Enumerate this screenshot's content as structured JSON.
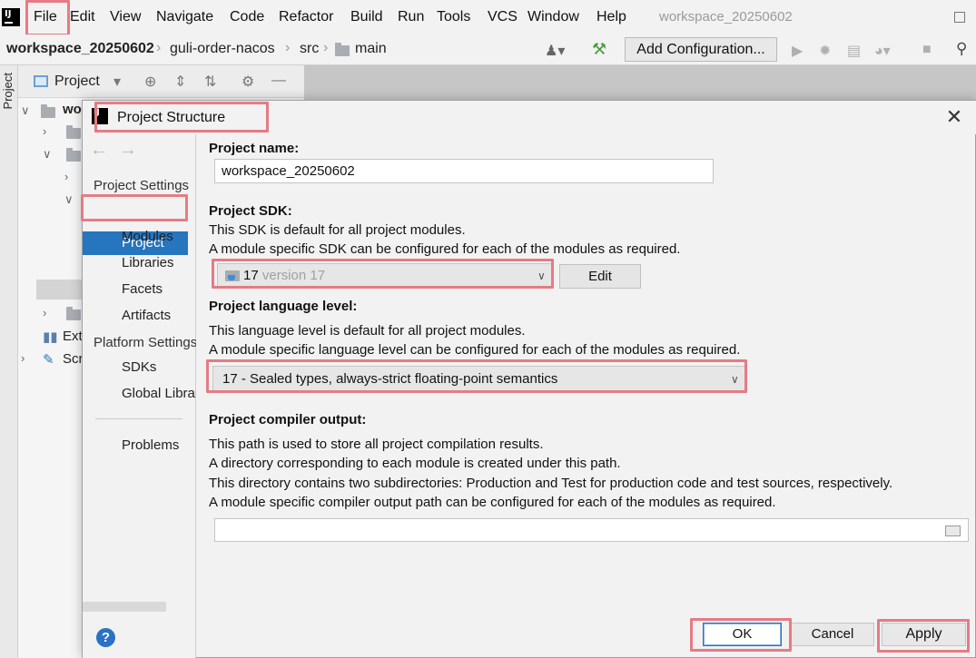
{
  "menubar": {
    "items": [
      "File",
      "Edit",
      "View",
      "Navigate",
      "Code",
      "Refactor",
      "Build",
      "Run",
      "Tools",
      "VCS",
      "Window",
      "Help"
    ],
    "window_title": "workspace_20250602"
  },
  "navbar": {
    "breadcrumbs": [
      "workspace_20250602",
      "guli-order-nacos",
      "src",
      "main"
    ],
    "add_configuration": "Add Configuration..."
  },
  "tool_window": {
    "strip_label": "Project",
    "title": "Project",
    "tree_visible": [
      "wo",
      "Ext",
      "Scr"
    ]
  },
  "dialog": {
    "title": "Project Structure",
    "sidebar": {
      "project_settings_header": "Project Settings",
      "project_settings_items": [
        "Project",
        "Modules",
        "Libraries",
        "Facets",
        "Artifacts"
      ],
      "selected": "Project",
      "platform_settings_header": "Platform Settings",
      "platform_settings_items": [
        "SDKs",
        "Global Libraries"
      ],
      "problems": "Problems"
    },
    "project_name": {
      "label": "Project name:",
      "value": "workspace_20250602"
    },
    "project_sdk": {
      "label": "Project SDK:",
      "desc1": "This SDK is default for all project modules.",
      "desc2": "A module specific SDK can be configured for each of the modules as required.",
      "selected_name": "17",
      "selected_version": "version 17",
      "edit_button": "Edit"
    },
    "language_level": {
      "label": "Project language level:",
      "desc1": "This language level is default for all project modules.",
      "desc2": "A module specific language level can be configured for each of the modules as required.",
      "selected": "17 - Sealed types, always-strict floating-point semantics"
    },
    "compiler_output": {
      "label": "Project compiler output:",
      "desc1": "This path is used to store all project compilation results.",
      "desc2": "A directory corresponding to each module is created under this path.",
      "desc3": "This directory contains two subdirectories: Production and Test for production code and test sources, respectively.",
      "desc4": "A module specific compiler output path can be configured for each of the modules as required.",
      "value": ""
    },
    "buttons": {
      "ok": "OK",
      "cancel": "Cancel",
      "apply": "Apply"
    }
  }
}
